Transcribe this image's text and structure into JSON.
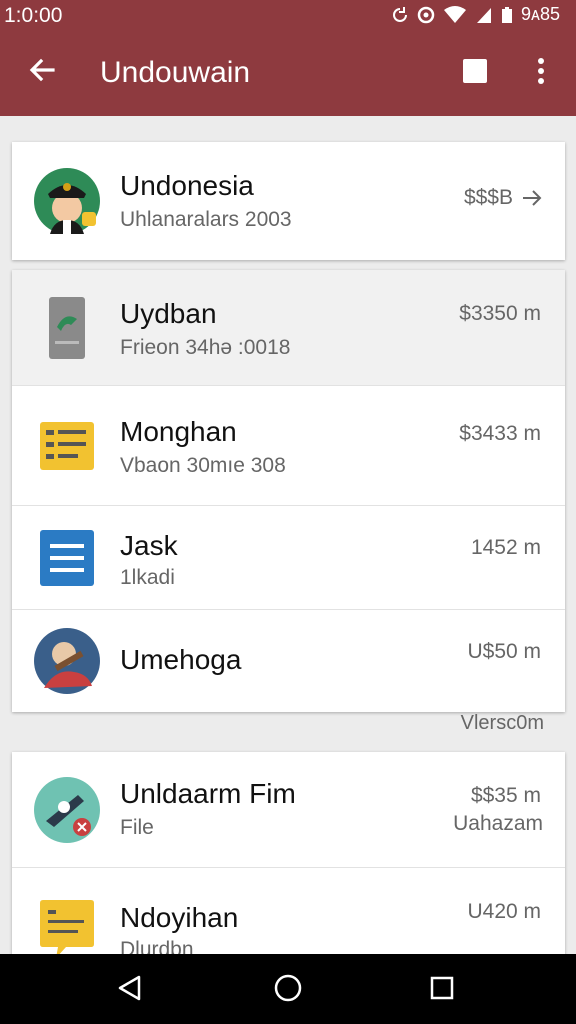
{
  "status_bar": {
    "time": "1:0:00",
    "battery_text": "9ᴀ85",
    "icons": [
      "sync-icon",
      "alarm-icon",
      "wifi-icon",
      "signal-icon",
      "battery-icon"
    ]
  },
  "toolbar": {
    "title": "Undouwain",
    "back_icon": "arrow-back-icon",
    "action_icon": "square-icon",
    "more_icon": "more-vert-icon"
  },
  "header_item": {
    "title": "Undonesia",
    "subtitle": "Uhlanaralars 2003",
    "amount": "$$$B",
    "avatar": "avatar-officer"
  },
  "list": [
    {
      "title": "Uydban",
      "subtitle": "Frieon 34hə :0018",
      "amount": "$3350 m",
      "icon": "file-green-icon",
      "selected": true
    },
    {
      "title": "Monghan",
      "subtitle": "Vbaon 30mıe 308",
      "amount": "$3433 m",
      "icon": "doc-yellow-icon"
    },
    {
      "title": "Jask",
      "subtitle": "1lkadi",
      "amount": "1452 m",
      "icon": "doc-blue-icon"
    },
    {
      "title": "Umehoga",
      "subtitle": "",
      "amount": "U$50 m",
      "icon": "photo-avatar-icon"
    }
  ],
  "section_caption": "Vlersc0m",
  "list2": [
    {
      "title": "Unldaarm Fim",
      "subtitle": "File",
      "amount": "$$35 m",
      "amount2": "Uahazam",
      "icon": "globe-pen-icon"
    },
    {
      "title": "Ndoyihan",
      "subtitle": "Dlurdbn",
      "amount": "U420 m",
      "icon": "chat-yellow-icon"
    }
  ],
  "colors": {
    "appbar": "#8e3a3f",
    "background": "#ececec",
    "card": "#ffffff",
    "navbar": "#000000"
  },
  "nav": {
    "back": "nav-back-icon",
    "home": "nav-home-icon",
    "recents": "nav-recents-icon"
  }
}
